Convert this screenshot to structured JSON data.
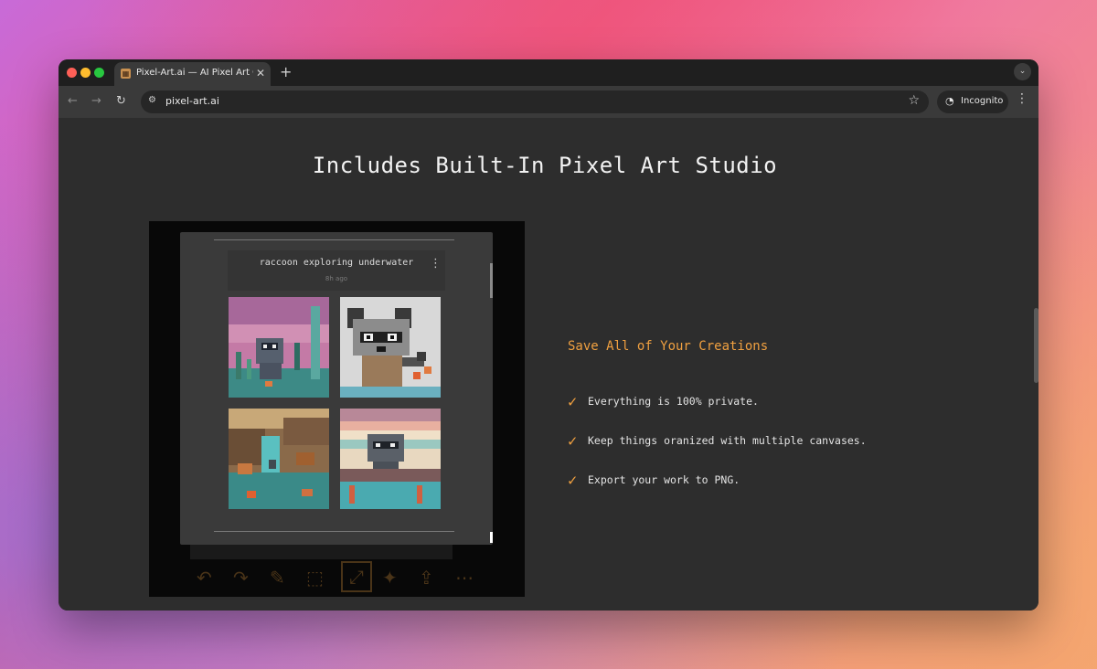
{
  "browser": {
    "tab_title": "Pixel-Art.ai — AI Pixel Art Generator",
    "tab_favicon": "pixel-art-favicon",
    "url": "pixel-art.ai",
    "incognito_label": "Incognito"
  },
  "page": {
    "heading": "Includes Built-In Pixel Art Studio"
  },
  "studio_preview": {
    "prompt_title": "raccoon exploring underwater",
    "timestamp": "8h ago",
    "images": [
      "raccoon-pink-underwater",
      "raccoon-closeup-flowers",
      "raccoon-ruins-waterfall",
      "raccoon-pastel-sky"
    ]
  },
  "features": {
    "title": "Save All of Your Creations",
    "items": [
      "Everything is 100% private.",
      "Keep things oranized with multiple canvases.",
      "Export your work to PNG."
    ]
  },
  "colors": {
    "accent": "#f0a040",
    "background": "#2d2d2d"
  }
}
